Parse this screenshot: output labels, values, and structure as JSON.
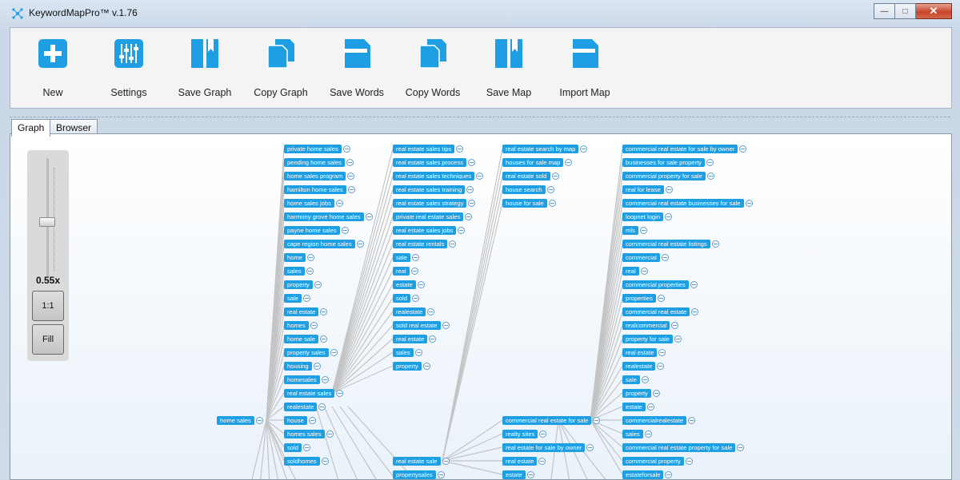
{
  "window": {
    "title": "KeywordMapPro™ v.1.76"
  },
  "toolbar": [
    {
      "label": "New",
      "icon": "plus-icon"
    },
    {
      "label": "Settings",
      "icon": "sliders-icon"
    },
    {
      "label": "Save Graph",
      "icon": "book-icon"
    },
    {
      "label": "Copy Graph",
      "icon": "copy-icon"
    },
    {
      "label": "Save Words",
      "icon": "save-icon"
    },
    {
      "label": "Copy Words",
      "icon": "copy-icon"
    },
    {
      "label": "Save Map",
      "icon": "book-icon"
    },
    {
      "label": "Import Map",
      "icon": "save-icon"
    }
  ],
  "tabs": [
    {
      "label": "Graph",
      "active": true
    },
    {
      "label": "Browser",
      "active": false
    }
  ],
  "zoom": {
    "value_label": "0.55x",
    "btn_1_1": "1:1",
    "btn_fill": "Fill",
    "level": 0.55
  },
  "graph": {
    "root": "home sales",
    "col1": [
      "private home sales",
      "pending home sales",
      "home sales program",
      "hamilton home sales",
      "home sales jobs",
      "harmony grove home sales",
      "payne home sales",
      "cape region home sales",
      "home",
      "sales",
      "property",
      "sale",
      "real estate",
      "homes",
      "home sale",
      "property sales",
      "housing",
      "homesales",
      "real estate sales",
      "realestate",
      "house",
      "homes sales",
      "sold",
      "soldhomes"
    ],
    "col2": [
      "real estate sales tips",
      "real estate sales process",
      "real estate sales techniques",
      "real estate sales training",
      "real estate sales strategy",
      "private real estate sales",
      "real estate sales jobs",
      "real estate rentals",
      "sale",
      "real",
      "estate",
      "sold",
      "realestate",
      "sold real estate",
      "real estate",
      "sales",
      "property",
      "real estate sale",
      "propertysales"
    ],
    "col3": [
      "real estate search by map",
      "houses for sale map",
      "real estate sold",
      "house search",
      "house for sale",
      "commercial real estate for sale",
      "realty sites",
      "real estate for sale by owner",
      "real estate",
      "estate"
    ],
    "col4": [
      "commercial real estate for sale by owner",
      "businesses for sale property",
      "commercial property for sale",
      "real for lease",
      "commercial real estate businesses for sale",
      "loopnet login",
      "mls",
      "commercial real estate listings",
      "commercial",
      "real",
      "commercial properties",
      "properties",
      "commercial real estate",
      "realcommercial",
      "property for sale",
      "real estate",
      "realestate",
      "sale",
      "property",
      "estate",
      "commercialrealestate",
      "sales",
      "commercial real estate property for sale",
      "commercial property",
      "estateforsale"
    ]
  }
}
